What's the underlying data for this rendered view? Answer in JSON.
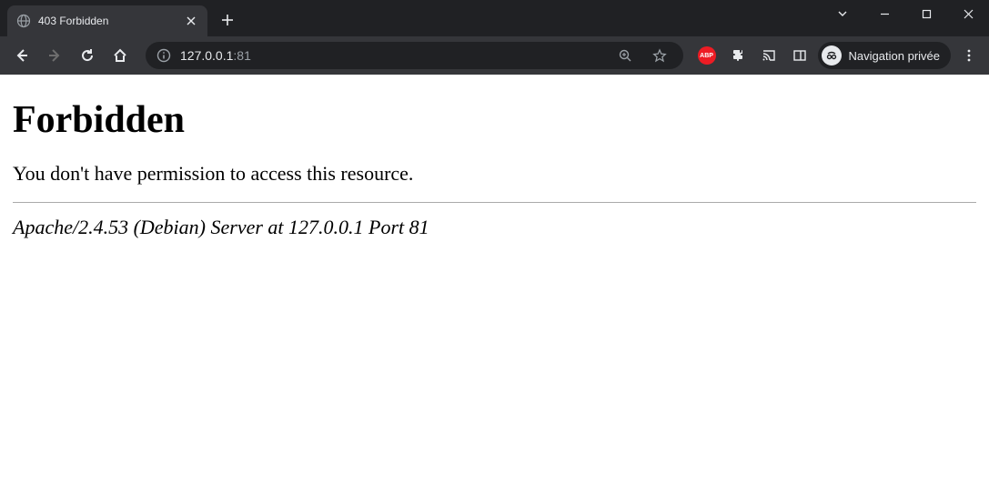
{
  "tab": {
    "title": "403 Forbidden"
  },
  "url": {
    "host": "127.0.0.1",
    "port": ":81"
  },
  "toolbar": {
    "incognito_label": "Navigation privée",
    "abp_label": "ABP"
  },
  "page": {
    "heading": "Forbidden",
    "message": "You don't have permission to access this resource.",
    "server_signature": "Apache/2.4.53 (Debian) Server at 127.0.0.1 Port 81"
  }
}
